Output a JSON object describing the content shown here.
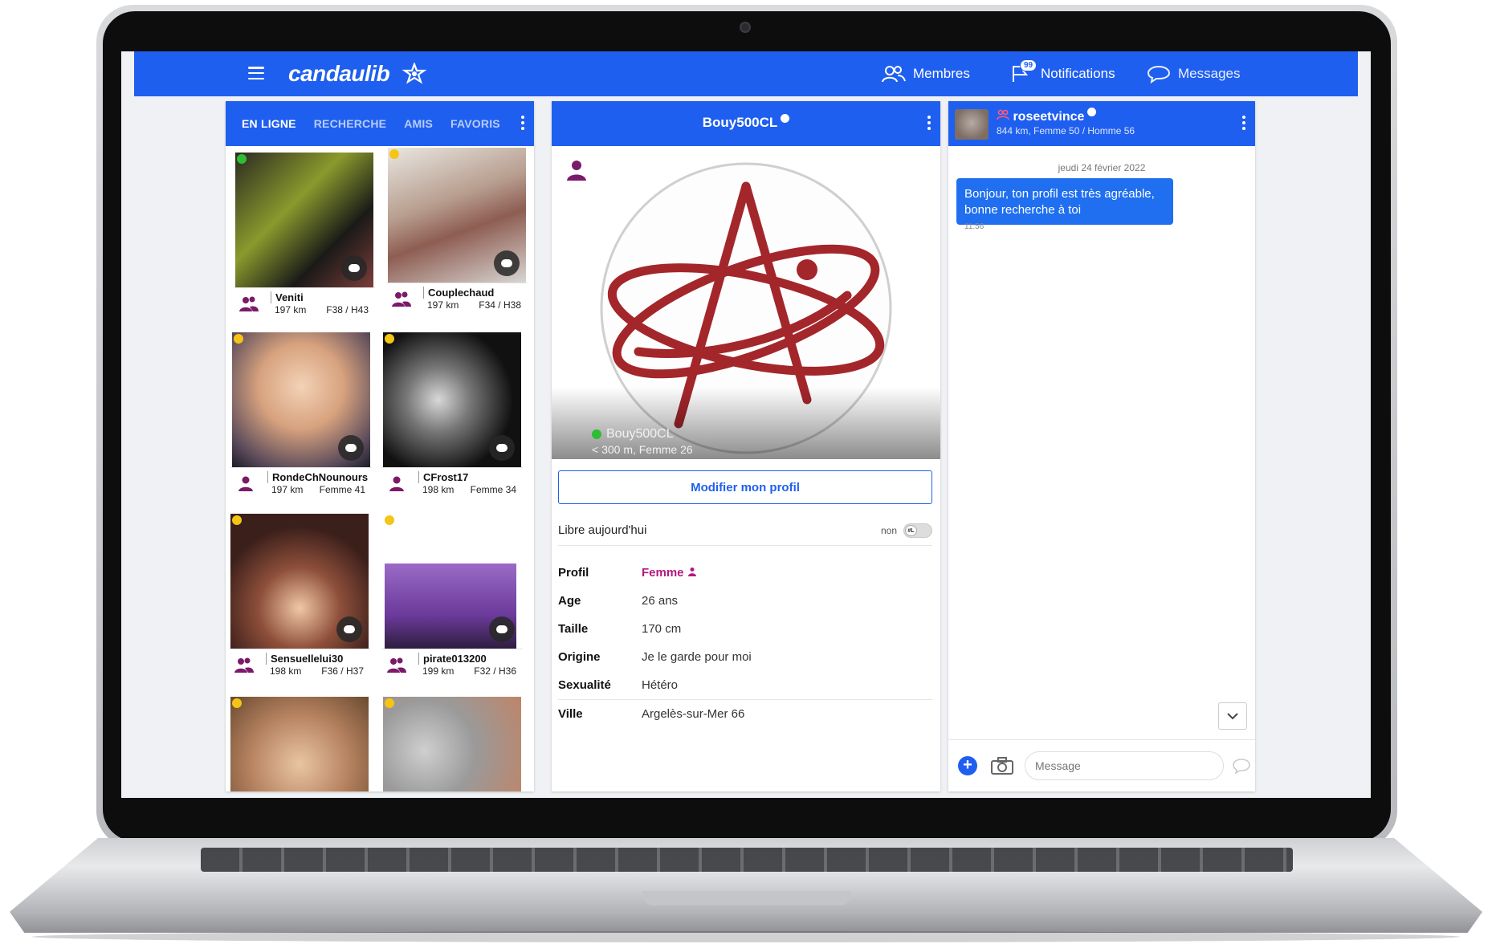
{
  "header": {
    "logo": "candaulib",
    "nav": [
      {
        "label": "Membres",
        "icon": "members-icon"
      },
      {
        "label": "Notifications",
        "icon": "flag-icon",
        "badge": "99"
      },
      {
        "label": "Messages",
        "icon": "message-icon"
      }
    ]
  },
  "left_panel": {
    "tabs": [
      "EN LIGNE",
      "RECHERCHE",
      "AMIS",
      "FAVORIS"
    ],
    "members": [
      {
        "name": "Veniti",
        "distance": "197 km",
        "ages": "F38 / H43",
        "status": "online",
        "verified": false,
        "type": "couple"
      },
      {
        "name": "Couplechaud",
        "distance": "197 km",
        "ages": "F34 / H38",
        "status": "away",
        "verified": true,
        "type": "couple"
      },
      {
        "name": "RondeChNounours",
        "distance": "197 km",
        "ages": "Femme 41",
        "status": "away",
        "verified": true,
        "type": "woman"
      },
      {
        "name": "CFrost17",
        "distance": "198 km",
        "ages": "Femme 34",
        "status": "away",
        "verified": true,
        "type": "woman"
      },
      {
        "name": "Sensuellelui30",
        "distance": "198 km",
        "ages": "F36 / H37",
        "status": "away",
        "verified": false,
        "type": "couple"
      },
      {
        "name": "pirate013200",
        "distance": "199 km",
        "ages": "F32 / H36",
        "status": "away",
        "verified": true,
        "type": "couple"
      },
      {
        "name": "",
        "distance": "",
        "ages": "",
        "status": "away",
        "verified": false,
        "type": ""
      },
      {
        "name": "",
        "distance": "",
        "ages": "",
        "status": "away",
        "verified": false,
        "type": ""
      }
    ]
  },
  "profile": {
    "username": "Bouy500CL",
    "subtitle": "< 300 m, Femme 26",
    "edit_button": "Modifier mon profil",
    "libre": {
      "label": "Libre aujourd'hui",
      "value": "non",
      "toggle_text": "#L"
    },
    "facts": [
      {
        "key": "Profil",
        "value": "Femme"
      },
      {
        "key": "Age",
        "value": "26 ans"
      },
      {
        "key": "Taille",
        "value": "170 cm"
      },
      {
        "key": "Origine",
        "value": "Je le garde pour moi"
      },
      {
        "key": "Sexualité",
        "value": "Hétéro"
      },
      {
        "key": "Ville",
        "value": "Argelès-sur-Mer 66"
      }
    ],
    "colors": {
      "accent": "#1f5ff0",
      "profile_value": "#b41781",
      "logo_red": "#a3262b"
    }
  },
  "conversation": {
    "name": "roseetvince",
    "details": "844 km, Femme 50 / Homme 56",
    "date": "jeudi 24 février 2022",
    "messages": [
      {
        "text": "Bonjour, ton profil est très agréable, bonne recherche à toi",
        "time": "11:56",
        "from": "me"
      }
    ],
    "input_placeholder": "Message"
  }
}
